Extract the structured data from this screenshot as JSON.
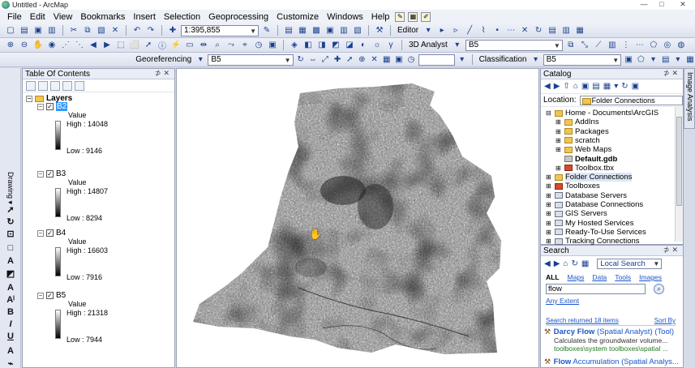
{
  "window": {
    "title": "Untitled - ArcMap",
    "minimize": "—",
    "maximize": "□",
    "close": "✕"
  },
  "menu": [
    "File",
    "Edit",
    "View",
    "Bookmarks",
    "Insert",
    "Selection",
    "Geoprocessing",
    "Customize",
    "Windows",
    "Help"
  ],
  "toolbar": {
    "scale": "1:395,855",
    "editor": "Editor",
    "analyst_3d": "3D Analyst",
    "analyst_layer": "B5",
    "georeferencing": "Georeferencing",
    "geo_layer": "B5",
    "classification": "Classification",
    "class_layer": "B5"
  },
  "toc": {
    "title": "Table Of Contents",
    "root": "Layers",
    "layers": [
      {
        "name": "B2",
        "value_label": "Value",
        "high": "High : 14048",
        "low": "Low : 9146",
        "selected": true
      },
      {
        "name": "B3",
        "value_label": "Value",
        "high": "High : 14807",
        "low": "Low : 8294",
        "selected": false
      },
      {
        "name": "B4",
        "value_label": "Value",
        "high": "High : 16603",
        "low": "Low : 7916",
        "selected": false
      },
      {
        "name": "B5",
        "value_label": "Value",
        "high": "High : 21318",
        "low": "Low : 7944",
        "selected": false
      }
    ]
  },
  "drawing": {
    "label": "Drawing ▾"
  },
  "catalog": {
    "title": "Catalog",
    "location_label": "Location:",
    "location_value": "Folder Connections",
    "tree": [
      {
        "label": "Home - Documents\\ArcGIS",
        "icon": "folder",
        "indent": 0,
        "expander": "⊟"
      },
      {
        "label": "AddIns",
        "icon": "folder",
        "indent": 1,
        "expander": "⊞"
      },
      {
        "label": "Packages",
        "icon": "folder",
        "indent": 1,
        "expander": "⊞"
      },
      {
        "label": "scratch",
        "icon": "folder",
        "indent": 1,
        "expander": "⊞"
      },
      {
        "label": "Web Maps",
        "icon": "folder",
        "indent": 1,
        "expander": "⊞"
      },
      {
        "label": "Default.gdb",
        "icon": "gdb",
        "indent": 1,
        "expander": "",
        "bold": true
      },
      {
        "label": "Toolbox.tbx",
        "icon": "toolbox",
        "indent": 1,
        "expander": "⊞"
      },
      {
        "label": "Folder Connections",
        "icon": "folder",
        "indent": 0,
        "expander": "⊞",
        "selected": true
      },
      {
        "label": "Toolboxes",
        "icon": "toolbox",
        "indent": 0,
        "expander": "⊞"
      },
      {
        "label": "Database Servers",
        "icon": "server",
        "indent": 0,
        "expander": "⊞"
      },
      {
        "label": "Database Connections",
        "icon": "server",
        "indent": 0,
        "expander": "⊞"
      },
      {
        "label": "GIS Servers",
        "icon": "server",
        "indent": 0,
        "expander": "⊞"
      },
      {
        "label": "My Hosted Services",
        "icon": "server",
        "indent": 0,
        "expander": "⊞"
      },
      {
        "label": "Ready-To-Use Services",
        "icon": "server",
        "indent": 0,
        "expander": "⊞"
      },
      {
        "label": "Tracking Connections",
        "icon": "server",
        "indent": 0,
        "expander": "⊞"
      }
    ]
  },
  "side_tab": "Image Analysis",
  "search": {
    "title": "Search",
    "scope": "Local Search",
    "tabs": [
      "ALL",
      "Maps",
      "Data",
      "Tools",
      "Images"
    ],
    "query": "flow",
    "extent": "Any Extent",
    "summary": "Search returned 18 items",
    "sort": "Sort By",
    "results": [
      {
        "title_bold": "Darcy Flow",
        "title_rest": " (Spatial Analyst) (Tool)",
        "desc": "Calculates the groundwater volume...",
        "path": "toolboxes\\system toolboxes\\spatial ..."
      },
      {
        "title_bold": "Flow",
        "title_rest": " Accumulation (Spatial Analys...",
        "desc": "",
        "path": ""
      }
    ]
  },
  "colors": {
    "accent": "#3399ff",
    "panel": "#d6dbe9",
    "link": "#1a56c9"
  }
}
